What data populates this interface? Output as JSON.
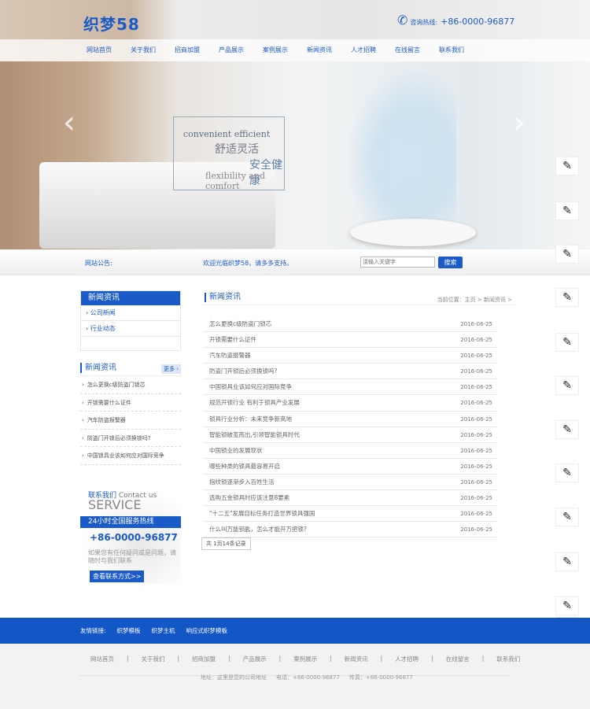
{
  "header": {
    "logo": "织梦58",
    "hotline_label": "咨询热线:",
    "hotline": "+86-0000-96877"
  },
  "nav": [
    "网站首页",
    "关于我们",
    "招商加盟",
    "产品展示",
    "案例展示",
    "新闻资讯",
    "人才招聘",
    "在线留言",
    "联系我们"
  ],
  "banner": {
    "line1": "convenient efficient",
    "line2": "舒适灵活",
    "line3": "安全健康",
    "line4": "flexibility and comfort"
  },
  "notice": {
    "label": "网站公告:",
    "text": "欢迎光临织梦58，请多多支持。",
    "search_placeholder": "请输入关键字",
    "search_button": "搜索"
  },
  "sidebar": {
    "title": "新闻资讯",
    "items": [
      "公司新闻",
      "行业动态"
    ]
  },
  "side_news": {
    "title": "新闻资讯",
    "more": "更多",
    "items": [
      "怎么更换c级防盗门锁芯",
      "开锁需要什么证件",
      "汽车防盗报警器",
      "防盗门开锁后必须换锁吗?",
      "中国锁具业该如何应对国际竞争"
    ]
  },
  "contact": {
    "cn": "联系我们",
    "en": "Contact us",
    "service": "SERVICE",
    "hotline_title": "24小时全国服务热线",
    "phone": "+86-0000-96877",
    "desc": "如果您有任何疑问或是问题，请随时与我们联系",
    "button": "查看联系方式>>"
  },
  "main": {
    "title": "新闻资讯",
    "breadcrumb": "当前位置：主页 > 新闻资讯 >",
    "articles": [
      {
        "title": "怎么更换c级防盗门锁芯",
        "date": "2016-06-25"
      },
      {
        "title": "开锁需要什么证件",
        "date": "2016-06-25"
      },
      {
        "title": "汽车防盗报警器",
        "date": "2016-06-25"
      },
      {
        "title": "防盗门开锁后必须换锁吗?",
        "date": "2016-06-25"
      },
      {
        "title": "中国锁具业该如何应对国际竞争",
        "date": "2016-06-25"
      },
      {
        "title": "规范开锁行业 有利于锁具产业发展",
        "date": "2016-06-25"
      },
      {
        "title": "锁具行业分析：未来竞争新高地",
        "date": "2016-06-25"
      },
      {
        "title": "智能锁破茧而出,引领智能锁具时代",
        "date": "2016-06-25"
      },
      {
        "title": "中国锁业的发展现状",
        "date": "2016-06-25"
      },
      {
        "title": "哪些种类的锁具最容易开启",
        "date": "2016-06-25"
      },
      {
        "title": "指纹锁逐渐步入百姓生活",
        "date": "2016-06-25"
      },
      {
        "title": "选购五金锁具时应该注意8要素",
        "date": "2016-06-25"
      },
      {
        "title": "\"十二五\"发展目标任务打造世界锁具强国",
        "date": "2016-06-25"
      },
      {
        "title": "什么叫万能钥匙，怎么才能开万把锁?",
        "date": "2016-06-25"
      }
    ],
    "pager": "共 1页14条记录"
  },
  "friend_links": {
    "label": "友情链接:",
    "items": [
      "织梦模板",
      "织梦主机",
      "响应式织梦模板"
    ]
  },
  "footer": {
    "nav": [
      "网站首页",
      "关于我们",
      "招商加盟",
      "产品展示",
      "案例展示",
      "新闻资讯",
      "人才招聘",
      "在线留言",
      "联系我们"
    ],
    "address": "地址：这里是您的公司地址",
    "tel": "电话：+86-0000-96877",
    "fax": "传真：+86-0000-96877"
  }
}
